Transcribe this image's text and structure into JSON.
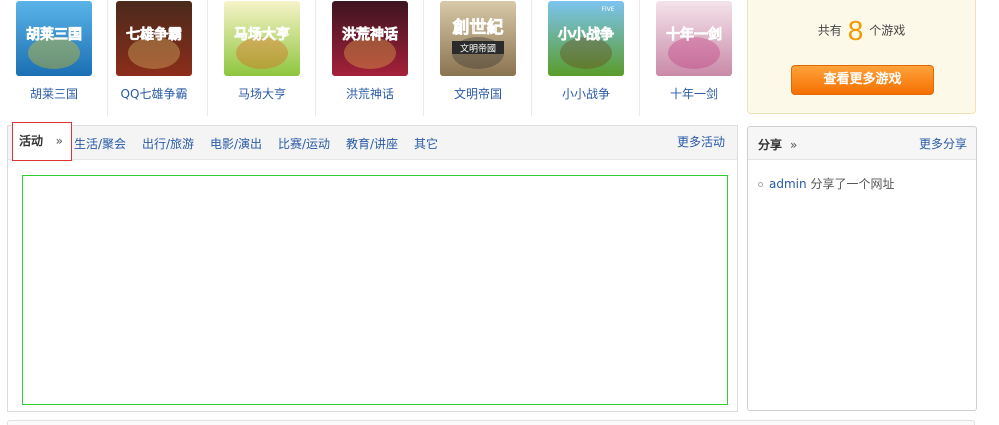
{
  "games": [
    {
      "name": "胡莱三国",
      "logo_text": "胡莱三国",
      "bg": [
        "#5ab4e8",
        "#1b6fb3"
      ],
      "accent": "#f5c800"
    },
    {
      "name": "QQ七雄争霸",
      "logo_text": "七雄争霸",
      "bg": [
        "#4a2a1c",
        "#8c2d1a"
      ],
      "accent": "#e9c870"
    },
    {
      "name": "马场大亨",
      "logo_text": "马场大亨",
      "bg": [
        "#f7f3c8",
        "#8ec63f"
      ],
      "accent": "#e25a12"
    },
    {
      "name": "洪荒神话",
      "logo_text": "洪荒神话",
      "bg": [
        "#3d1420",
        "#a5203a"
      ],
      "accent": "#f2c14e"
    },
    {
      "name": "文明帝国",
      "logo_text": "創世紀",
      "logo_sub": "文明帝國",
      "bg": [
        "#d8c9a8",
        "#8a7350"
      ],
      "accent": "#2b2b2b"
    },
    {
      "name": "小小战争",
      "logo_text": "小小战争",
      "logo_small": "FIVE",
      "bg": [
        "#7cc4ef",
        "#5a9c2a"
      ],
      "accent": "#6b3d12"
    },
    {
      "name": "十年一剑",
      "logo_text": "十年一剑",
      "bg": [
        "#f4e3ea",
        "#c98aa8"
      ],
      "accent": "#c0317a"
    }
  ],
  "games_total": {
    "prefix": "共有",
    "count": "8",
    "suffix": "个游戏",
    "button_label": "查看更多游戏"
  },
  "activity": {
    "current_tab": "活动",
    "current_tab_arrow": "»",
    "tabs": [
      "生活/聚会",
      "出行/旅游",
      "电影/演出",
      "比赛/运动",
      "教育/讲座",
      "其它"
    ],
    "more_label": "更多活动"
  },
  "share": {
    "title": "分享",
    "title_arrow": "»",
    "more_label": "更多分享",
    "items": [
      {
        "user": "admin",
        "text": "分享了一个网址"
      }
    ]
  },
  "colors": {
    "link": "#2a5aa7",
    "accent_orange": "#f39800",
    "active_tab_border": "#dd3333",
    "content_frame_border": "#33cc33"
  }
}
